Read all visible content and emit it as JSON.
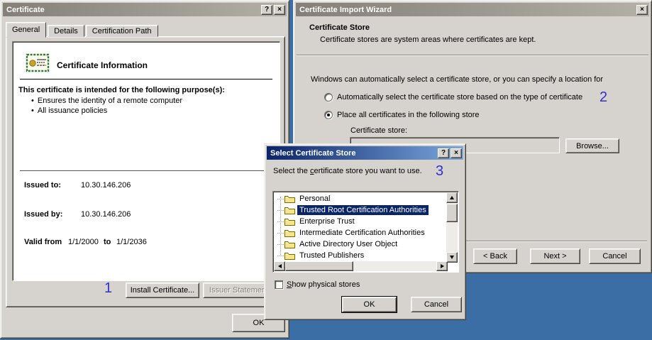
{
  "colors": {
    "desktop": "#3a6ea5",
    "dialog_bg": "#d6d3ce",
    "selection": "#0a246a",
    "annotation": "#2f2fd3",
    "titlebar_active_start": "#0a246a",
    "titlebar_active_end": "#7ba7dd",
    "titlebar_inactive_start": "#847f78",
    "titlebar_inactive_end": "#b4b0a5"
  },
  "icons": {
    "help": "?",
    "close": "×"
  },
  "annotations": {
    "step1": "1",
    "step2": "2",
    "step3": "3"
  },
  "certificate_dialog": {
    "title": "Certificate",
    "tabs": [
      {
        "label": "General"
      },
      {
        "label": "Details"
      },
      {
        "label": "Certification Path"
      }
    ],
    "info_title": "Certificate Information",
    "purpose_heading": "This certificate is intended for the following purpose(s):",
    "purposes": [
      {
        "text": "Ensures the identity of a remote computer"
      },
      {
        "text": "All issuance policies"
      }
    ],
    "issued_to_label": "Issued to:",
    "issued_to_value": "10.30.146.206",
    "issued_by_label": "Issued by:",
    "issued_by_value": "10.30.146.206",
    "valid_from_label": "Valid from",
    "valid_from_value": "1/1/2000",
    "valid_to_label": "to",
    "valid_to_value": "1/1/2036",
    "install_button": "Install Certificate...",
    "issuer_statement_button": "Issuer Statement",
    "ok_button": "OK"
  },
  "wizard": {
    "title": "Certificate Import Wizard",
    "heading": "Certificate Store",
    "subheading": "Certificate stores are system areas where certificates are kept.",
    "intro": "Windows can automatically select a certificate store, or you can specify a location for",
    "radio_auto": "Automatically select the certificate store based on the type of certificate",
    "radio_place": "Place all certificates in the following store",
    "store_label": "Certificate store:",
    "store_value": "",
    "browse_button": "Browse...",
    "back_button": "< Back",
    "next_button": "Next >",
    "cancel_button": "Cancel"
  },
  "select_store_dialog": {
    "title": "Select Certificate Store",
    "instruction_pre": "Select the ",
    "instruction_u": "c",
    "instruction_post": "ertificate store you want to use.",
    "stores": [
      {
        "label": "Personal",
        "selected": false
      },
      {
        "label": "Trusted Root Certification Authorities",
        "selected": true
      },
      {
        "label": "Enterprise Trust",
        "selected": false
      },
      {
        "label": "Intermediate Certification Authorities",
        "selected": false
      },
      {
        "label": "Active Directory User Object",
        "selected": false
      },
      {
        "label": "Trusted Publishers",
        "selected": false
      }
    ],
    "checkbox_u": "S",
    "checkbox_rest": "how physical stores",
    "ok_button": "OK",
    "cancel_button": "Cancel"
  }
}
